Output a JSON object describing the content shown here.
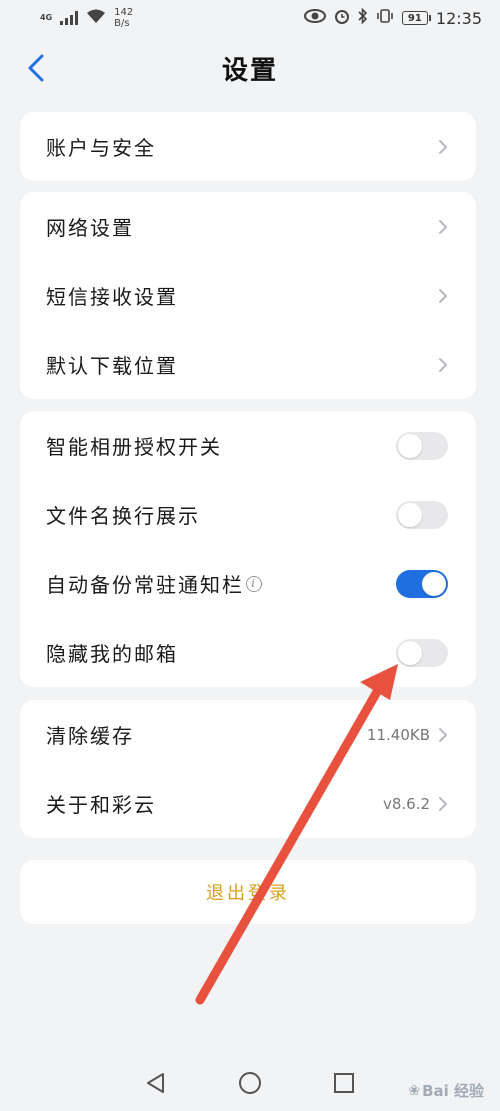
{
  "status_bar": {
    "network": "4G",
    "speed_value": "142",
    "speed_unit": "B/s",
    "battery": "91",
    "time": "12:35",
    "icons": [
      "eye-icon",
      "alarm-icon",
      "bluetooth-icon",
      "vibrate-icon"
    ]
  },
  "header": {
    "title": "设置"
  },
  "groups": [
    {
      "rows": [
        {
          "label": "账户与安全",
          "type": "chevron"
        }
      ]
    },
    {
      "rows": [
        {
          "label": "网络设置",
          "type": "chevron"
        },
        {
          "label": "短信接收设置",
          "type": "chevron"
        },
        {
          "label": "默认下载位置",
          "type": "chevron"
        }
      ]
    },
    {
      "rows": [
        {
          "label": "智能相册授权开关",
          "type": "toggle",
          "on": false
        },
        {
          "label": "文件名换行展示",
          "type": "toggle",
          "on": false
        },
        {
          "label": "自动备份常驻通知栏",
          "type": "toggle",
          "on": true,
          "info": "i"
        },
        {
          "label": "隐藏我的邮箱",
          "type": "toggle",
          "on": false
        }
      ]
    },
    {
      "rows": [
        {
          "label": "清除缓存",
          "type": "chevron",
          "value": "11.40KB"
        },
        {
          "label": "关于和彩云",
          "type": "chevron",
          "value": "v8.6.2"
        }
      ]
    }
  ],
  "logout": {
    "label": "退出登录"
  },
  "watermark": {
    "text": "Bai 经验"
  },
  "colors": {
    "accent": "#1f6fe0",
    "logout": "#d9a01c",
    "annotation_arrow": "#e8513d"
  }
}
